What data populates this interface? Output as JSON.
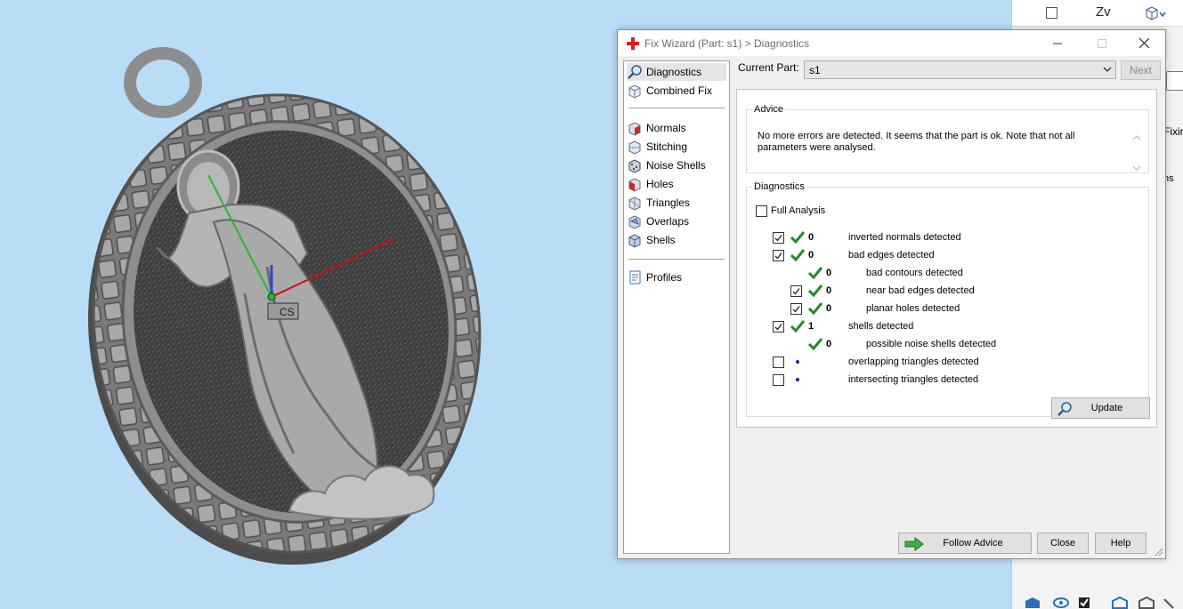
{
  "window": {
    "title": "Fix Wizard (Part: s1) > Diagnostics",
    "controls": [
      "minimize-icon",
      "maximize-icon",
      "close-icon"
    ]
  },
  "viewport": {
    "cs_label": "CS",
    "axis_colors": {
      "x": "#d01010",
      "y": "#29b829",
      "z": "#2d44d8"
    },
    "background": "#b9dcf7"
  },
  "side_panel": {
    "axis_label": "Z",
    "fixing_label": "Fixir",
    "ns_label": "ns"
  },
  "nav": {
    "items": [
      {
        "label": "Diagnostics",
        "icon": "magnifier-icon",
        "selected": true
      },
      {
        "label": "Combined Fix",
        "icon": "combined-fix-icon"
      },
      {
        "label": "Normals",
        "icon": "normals-icon"
      },
      {
        "label": "Stitching",
        "icon": "stitching-icon"
      },
      {
        "label": "Noise Shells",
        "icon": "noise-shells-icon"
      },
      {
        "label": "Holes",
        "icon": "holes-icon"
      },
      {
        "label": "Triangles",
        "icon": "triangles-icon"
      },
      {
        "label": "Overlaps",
        "icon": "overlaps-icon"
      },
      {
        "label": "Shells",
        "icon": "shells-icon"
      },
      {
        "label": "Profiles",
        "icon": "profiles-icon"
      }
    ]
  },
  "current_part": {
    "label": "Current Part:",
    "value": "s1",
    "next_label": "Next"
  },
  "advice": {
    "legend": "Advice",
    "text": "No more errors are detected. It seems that the part is ok. Note that not all parameters were analysed."
  },
  "diagnostics": {
    "legend": "Diagnostics",
    "full_analysis_label": "Full Analysis",
    "full_analysis_checked": false,
    "rows": [
      {
        "checkbox": true,
        "checked": true,
        "status": "ok",
        "count": "0",
        "label": "inverted normals detected",
        "indent": 0
      },
      {
        "checkbox": true,
        "checked": true,
        "status": "ok",
        "count": "0",
        "label": "bad edges detected",
        "indent": 0
      },
      {
        "checkbox": false,
        "checked": false,
        "status": "ok",
        "count": "0",
        "label": "bad contours detected",
        "indent": 1
      },
      {
        "checkbox": true,
        "checked": true,
        "status": "ok",
        "count": "0",
        "label": "near bad edges detected",
        "indent": 1
      },
      {
        "checkbox": true,
        "checked": true,
        "status": "ok",
        "count": "0",
        "label": "planar holes detected",
        "indent": 1
      },
      {
        "checkbox": true,
        "checked": true,
        "status": "ok",
        "count": "1",
        "label": "shells detected",
        "indent": 0
      },
      {
        "checkbox": false,
        "checked": false,
        "status": "ok",
        "count": "0",
        "label": "possible noise shells detected",
        "indent": 1
      },
      {
        "checkbox": true,
        "checked": false,
        "status": "pending",
        "count": "",
        "label": "overlapping triangles detected",
        "indent": 0
      },
      {
        "checkbox": true,
        "checked": false,
        "status": "pending",
        "count": "",
        "label": "intersecting triangles detected",
        "indent": 0
      }
    ],
    "update_label": "Update"
  },
  "buttons": {
    "follow_advice": "Follow Advice",
    "close": "Close",
    "help": "Help"
  }
}
